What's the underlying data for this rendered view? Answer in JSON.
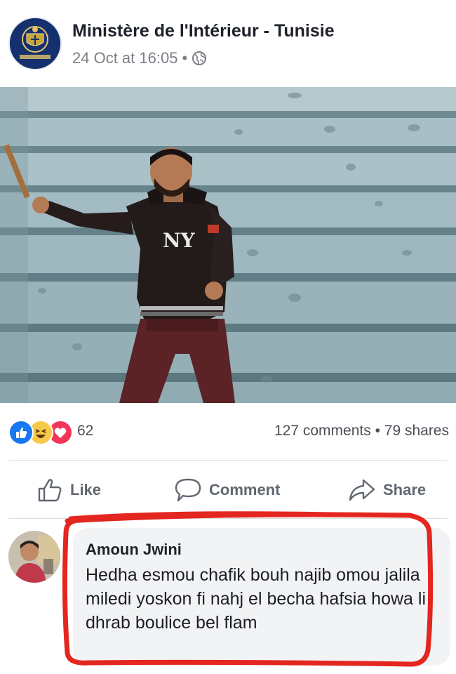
{
  "post": {
    "page_name": "Ministère de l'Intérieur - Tunisie",
    "timestamp": "24 Oct at 16:05",
    "separator": "•",
    "privacy_icon": "globe-icon"
  },
  "photo": {
    "jacket_logo": "NY"
  },
  "reactions": {
    "icons": [
      "like-reaction-icon",
      "haha-reaction-icon",
      "love-reaction-icon"
    ],
    "count": "62",
    "comments": "127 comments",
    "separator": "•",
    "shares": "79 shares"
  },
  "actions": {
    "like": "Like",
    "comment": "Comment",
    "share": "Share"
  },
  "comment": {
    "author": "Amoun Jwini",
    "text": "Hedha esmou chafik bouh najib omou jalila miledi yoskon fi nahj el becha hafsia howa li dhrab boulice bel flam"
  },
  "colors": {
    "like_blue": "#1877f2",
    "haha_yellow": "#f7c94a",
    "love_red": "#f0365a",
    "highlight_red": "#e3261f",
    "muted_text": "#606770"
  }
}
